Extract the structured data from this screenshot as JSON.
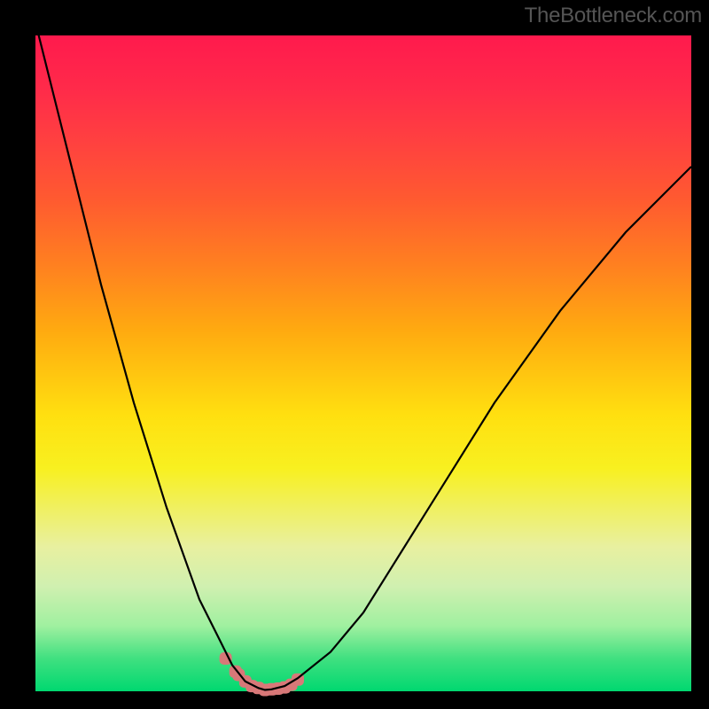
{
  "watermark": "TheBottleneck.com",
  "chart_data": {
    "type": "line",
    "title": "",
    "xlabel": "",
    "ylabel": "",
    "xlim": [
      0,
      100
    ],
    "ylim": [
      0,
      100
    ],
    "grid": false,
    "description": "Bottleneck curve: V-shaped black curve reaching minimum near x≈35. Background vertical gradient from red (top, high bottleneck) through yellow to green (bottom, optimal). Pink/salmon markers cluster near the curve minimum.",
    "series": [
      {
        "name": "bottleneck-curve",
        "color": "#000000",
        "x": [
          0,
          5,
          10,
          15,
          20,
          25,
          28,
          30,
          32,
          34,
          35,
          36,
          38,
          40,
          45,
          50,
          55,
          60,
          70,
          80,
          90,
          100
        ],
        "y": [
          102,
          82,
          62,
          44,
          28,
          14,
          8,
          4,
          1.5,
          0.5,
          0.2,
          0.3,
          0.8,
          2,
          6,
          12,
          20,
          28,
          44,
          58,
          70,
          80
        ]
      },
      {
        "name": "optimal-markers",
        "color": "#d87878",
        "type": "scatter",
        "x": [
          29,
          30.5,
          31,
          32,
          33,
          34,
          35,
          36,
          37,
          38,
          39,
          40
        ],
        "y": [
          5,
          3,
          2.5,
          1.5,
          0.8,
          0.5,
          0.2,
          0.3,
          0.4,
          0.6,
          1.0,
          1.8
        ]
      }
    ]
  },
  "colors": {
    "top": "#ff1a4d",
    "mid": "#ffe010",
    "bottom": "#00d870",
    "marker": "#d87878",
    "curve": "#000000"
  }
}
